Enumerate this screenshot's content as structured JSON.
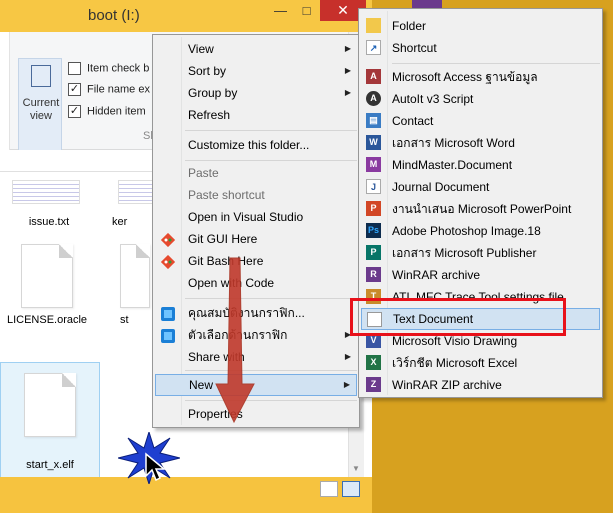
{
  "window": {
    "title": "boot (I:)",
    "minimize": "—",
    "maximize": "□",
    "close": "✕"
  },
  "ribbon": {
    "current_view": "Current view",
    "checkbox_item": "Item check b",
    "checkbox_ext": "File name ex",
    "checkbox_hidden": "Hidden item",
    "group_label": "Sh"
  },
  "files": [
    {
      "name": "issue.txt"
    },
    {
      "name": "ker"
    },
    {
      "name": "LICENSE.oracle"
    },
    {
      "name": "st"
    },
    {
      "name": "start_x.elf"
    }
  ],
  "context_menu": {
    "items": [
      {
        "label": "View"
      },
      {
        "label": "Sort by"
      },
      {
        "label": "Group by"
      },
      {
        "label": "Refresh"
      },
      {
        "label": "Customize this folder..."
      },
      {
        "label": "Paste"
      },
      {
        "label": "Paste shortcut"
      },
      {
        "label": "Open in Visual Studio"
      },
      {
        "label": "Git GUI Here"
      },
      {
        "label": "Git Bash Here"
      },
      {
        "label": "Open with Code"
      },
      {
        "label": "คุณสมบัติงานกราฟิก..."
      },
      {
        "label": "ตัวเลือกด้านกราฟิก"
      },
      {
        "label": "Share with"
      },
      {
        "label": "New"
      },
      {
        "label": "Properties"
      }
    ]
  },
  "new_submenu": {
    "items": [
      {
        "label": "Folder"
      },
      {
        "label": "Shortcut"
      },
      {
        "label": "Microsoft Access ฐานข้อมูล"
      },
      {
        "label": "AutoIt v3 Script"
      },
      {
        "label": "Contact"
      },
      {
        "label": "เอกสาร Microsoft Word"
      },
      {
        "label": "MindMaster.Document"
      },
      {
        "label": "Journal Document"
      },
      {
        "label": "งานนำเสนอ Microsoft PowerPoint"
      },
      {
        "label": "Adobe Photoshop Image.18"
      },
      {
        "label": "เอกสาร Microsoft Publisher"
      },
      {
        "label": "WinRAR archive"
      },
      {
        "label": "ATL MFC Trace Tool settings file"
      },
      {
        "label": "Text Document"
      },
      {
        "label": "Microsoft Visio Drawing"
      },
      {
        "label": "เวิร์กชีต Microsoft Excel"
      },
      {
        "label": "WinRAR ZIP archive"
      }
    ]
  },
  "colors": {
    "highlight": "#d1e2f2",
    "annotation_red": "#e8111a",
    "arrow": "#c0392b",
    "star": "#1f3fd0"
  }
}
